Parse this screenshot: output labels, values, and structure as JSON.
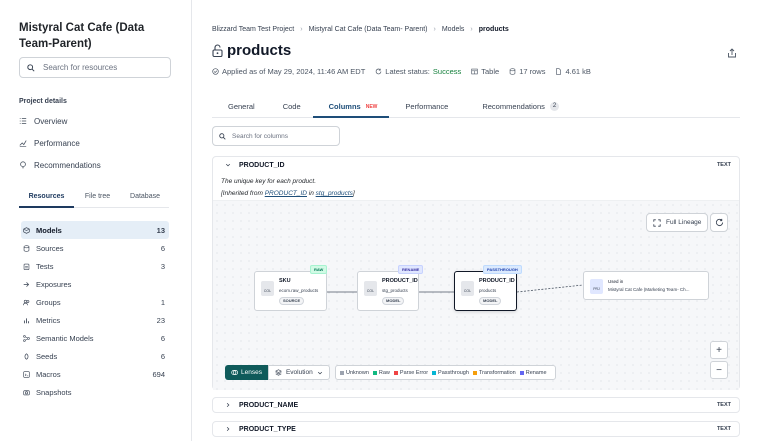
{
  "project": {
    "title": "Mistyral Cat Cafe (Data Team-Parent)"
  },
  "sidebar": {
    "search_placeholder": "Search for resources",
    "section_label": "Project details",
    "nav": [
      {
        "label": "Overview",
        "icon": "list-icon"
      },
      {
        "label": "Performance",
        "icon": "chart-icon"
      },
      {
        "label": "Recommendations",
        "icon": "bulb-icon"
      }
    ],
    "tabs": [
      {
        "label": "Resources",
        "active": true
      },
      {
        "label": "File tree"
      },
      {
        "label": "Database"
      }
    ],
    "resources": [
      {
        "label": "Models",
        "count": "13",
        "active": true
      },
      {
        "label": "Sources",
        "count": "6"
      },
      {
        "label": "Tests",
        "count": "3"
      },
      {
        "label": "Exposures",
        "count": ""
      },
      {
        "label": "Groups",
        "count": "1"
      },
      {
        "label": "Metrics",
        "count": "23"
      },
      {
        "label": "Semantic Models",
        "count": "6"
      },
      {
        "label": "Seeds",
        "count": "6"
      },
      {
        "label": "Macros",
        "count": "694"
      },
      {
        "label": "Snapshots",
        "count": ""
      }
    ]
  },
  "breadcrumb": [
    "Blizzard Team Test Project",
    "Mistyral Cat Cafe (Data Team- Parent)",
    "Models",
    "products"
  ],
  "page": {
    "title": "products"
  },
  "meta": {
    "applied": "Applied as of May 29, 2024, 11:46 AM EDT",
    "status_label": "Latest status:",
    "status_value": "Success",
    "kind": "Table",
    "rows": "17 rows",
    "size": "4.61 kB"
  },
  "tabs": [
    {
      "label": "General"
    },
    {
      "label": "Code"
    },
    {
      "label": "Columns",
      "badge": "NEW",
      "active": true
    },
    {
      "label": "Performance"
    },
    {
      "label": "Recommendations",
      "count": "2"
    }
  ],
  "columns_search_placeholder": "Search for columns",
  "expanded_column": {
    "name": "PRODUCT_ID",
    "type": "TEXT",
    "description": "The unique key for each product.",
    "inherited_prefix": "[Inherited from ",
    "inherited_col": "PRODUCT_ID",
    "inherited_mid": " in ",
    "inherited_model": "stg_products",
    "inherited_suffix": "]"
  },
  "lineage": {
    "full_lineage": "Full Lineage",
    "nodes": [
      {
        "title": "SKU",
        "sub": "ecom.raw_products",
        "type": "SOURCE",
        "tag": "RAW",
        "icon": "COL"
      },
      {
        "title": "PRODUCT_ID",
        "sub": "stg_products",
        "type": "MODEL",
        "tag": "RENAME",
        "icon": "COL"
      },
      {
        "title": "PRODUCT_ID",
        "sub": "products",
        "type": "MODEL",
        "tag": "PASSTHROUGH",
        "icon": "COL"
      },
      {
        "title": "Used in",
        "sub": "Mistyral Cat Cafe (Marketing Team- Ch...",
        "icon": "PRJ"
      }
    ],
    "lenses": "Lenses",
    "evolution": "Evolution",
    "legend": [
      {
        "label": "Unknown",
        "color": "#9ca3af"
      },
      {
        "label": "Raw",
        "color": "#10b981"
      },
      {
        "label": "Parse Error",
        "color": "#ef4444"
      },
      {
        "label": "Passthrough",
        "color": "#06b6d4"
      },
      {
        "label": "Transformation",
        "color": "#f59e0b"
      },
      {
        "label": "Rename",
        "color": "#6366f1"
      }
    ]
  },
  "other_columns": [
    {
      "name": "PRODUCT_NAME",
      "type": "TEXT"
    },
    {
      "name": "PRODUCT_TYPE",
      "type": "TEXT"
    }
  ]
}
